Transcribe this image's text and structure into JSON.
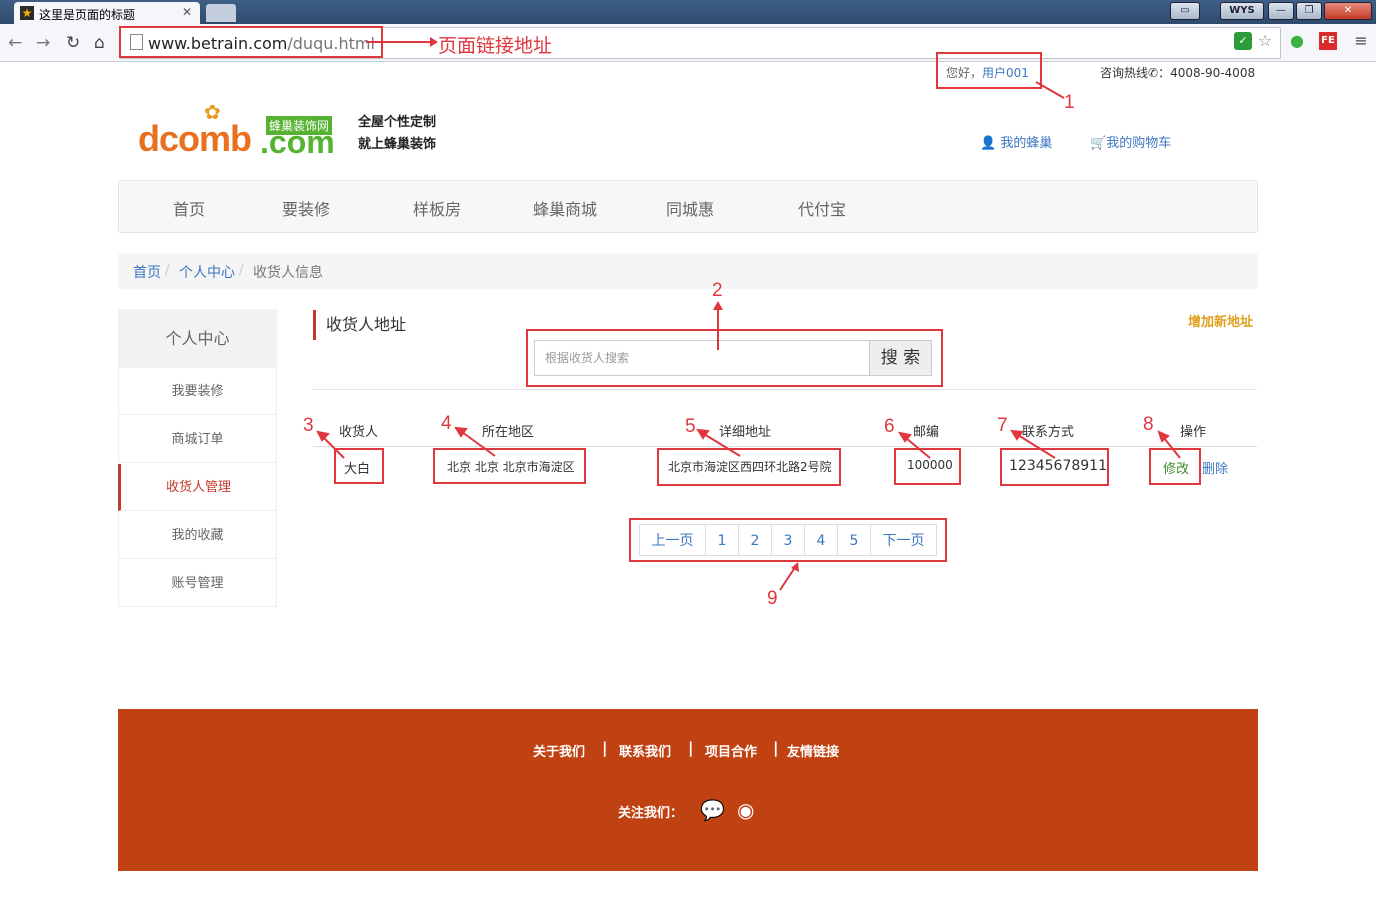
{
  "browser": {
    "tab_title": "这里是页面的标题",
    "tab_icon": "star-icon",
    "window_profile": "WYS",
    "url_host": "www.betrain.com",
    "url_path": "/duqu.html",
    "url_annotation": "页面链接地址"
  },
  "header": {
    "greeting_prefix": "您好，",
    "username": "用户001",
    "hotline_label": "咨询热线",
    "hotline_number": "：4008-90-4008",
    "logo_text": "dcomb",
    "logo_suffix": ".com",
    "logo_badge": "蜂巢装饰网",
    "slogan_line1": "全屋个性定制",
    "slogan_line2": "就上蜂巢装饰",
    "my_honeycomb": "我的蜂巢",
    "my_cart": "我的购物车"
  },
  "nav": [
    "首页",
    "要装修",
    "样板房",
    "蜂巢商城",
    "同城惠",
    "代付宝"
  ],
  "breadcrumb": {
    "home": "首页",
    "center": "个人中心",
    "current": "收货人信息",
    "sep": "/"
  },
  "sidebar": {
    "title": "个人中心",
    "items": [
      "我要装修",
      "商城订单",
      "收货人管理",
      "我的收藏",
      "账号管理"
    ],
    "active_index": 2
  },
  "content": {
    "section_title": "收货人地址",
    "add_address": "增加新地址",
    "search_placeholder": "根据收货人搜索",
    "search_button": "搜 索",
    "columns": [
      "收货人",
      "所在地区",
      "详细地址",
      "邮编",
      "联系方式",
      "操作"
    ],
    "row": {
      "name": "大白",
      "region": "北京 北京 北京市海淀区",
      "address": "北京市海淀区西四环北路2号院",
      "zip": "100000",
      "phone": "12345678911",
      "edit": "修改",
      "delete": "删除"
    }
  },
  "pager": {
    "prev": "上一页",
    "pages": [
      "1",
      "2",
      "3",
      "4",
      "5"
    ],
    "next": "下一页"
  },
  "footer": {
    "links": [
      "关于我们",
      "联系我们",
      "项目合作",
      "友情链接"
    ],
    "sep": "|",
    "follow": "关注我们："
  },
  "annotations": [
    "1",
    "2",
    "3",
    "4",
    "5",
    "6",
    "7",
    "8",
    "9"
  ],
  "colors": {
    "accent": "#c0392b",
    "footer": "#c04112",
    "link": "#3b77c2",
    "annotation": "#e0373f",
    "add": "#e0a020",
    "edit": "#3a8d2a"
  }
}
